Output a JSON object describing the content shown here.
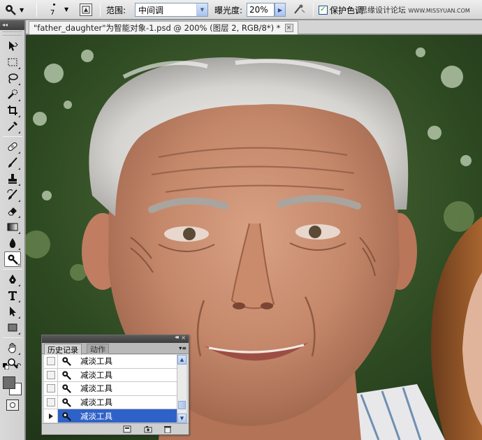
{
  "options_bar": {
    "brush_size": "7",
    "range_label": "范围:",
    "range_value": "中间调",
    "exposure_label": "曝光度:",
    "exposure_value": "20%",
    "protect_tones_label": "保护色调",
    "protect_tones_checked": true,
    "watermark_cn": "思缘设计论坛",
    "watermark_url": "WWW.MISSYUAN.COM",
    "check_mark": "✓"
  },
  "tool_panel": {
    "header": "◂◂",
    "active_tool": "dodge-burn-sponge-tool",
    "foreground_color": "#6c6c6c",
    "background_color": "#ffffff"
  },
  "document": {
    "tab_title": "\"father_daughter\"为智能对象-1.psd @ 200% (图层 2, RGB/8*) *",
    "close_glyph": "×"
  },
  "history_panel": {
    "tabs": [
      "历史记录",
      "动作"
    ],
    "active_tab": "历史记录",
    "collapse_glyph": "◂◂",
    "close_glyph": "×",
    "menu_glyph": "▾≡",
    "items": [
      {
        "label": "减淡工具",
        "selected": false
      },
      {
        "label": "减淡工具",
        "selected": false
      },
      {
        "label": "减淡工具",
        "selected": false
      },
      {
        "label": "减淡工具",
        "selected": false
      },
      {
        "label": "减淡工具",
        "selected": true
      }
    ],
    "scroll_up": "▲",
    "scroll_down": "▼",
    "bottom_icons": [
      "new-document-from-state-icon",
      "new-snapshot-icon",
      "delete-state-icon"
    ]
  },
  "colors": {
    "accent_selection": "#2f62c8",
    "panel_gray": "#d4d4d4"
  }
}
